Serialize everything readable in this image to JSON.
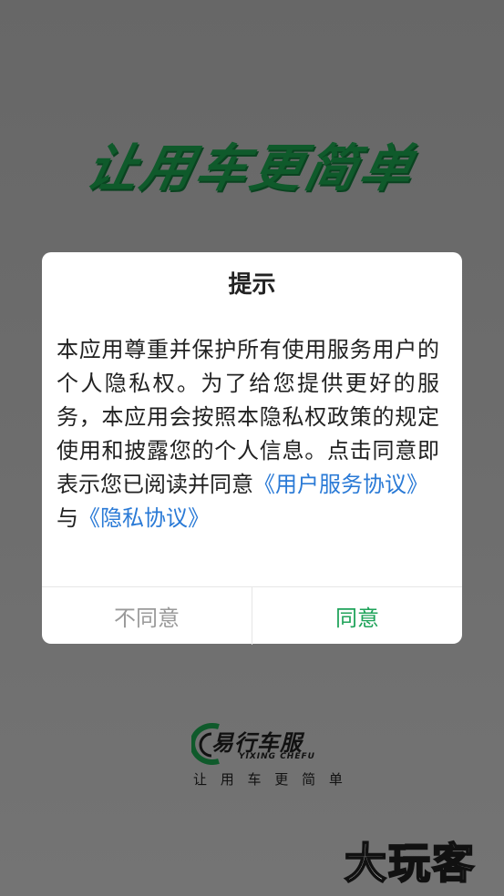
{
  "background": {
    "slogan": "让用车更简单"
  },
  "dialog": {
    "title": "提示",
    "body_text": "本应用尊重并保护所有使用服务用户的个人隐私权。为了给您提供更好的服务，本应用会按照本隐私权政策的规定使用和披露您的个人信息。点击同意即表示您已阅读并同意",
    "user_agreement_link": "《用户服务协议》",
    "connector": "与",
    "privacy_link": "《隐私协议》",
    "disagree_label": "不同意",
    "agree_label": "同意"
  },
  "brand": {
    "name": "易行车服",
    "name_en": "YIXING CHEFU",
    "slogan": "让 用 车 更 简 单"
  },
  "watermark": "大玩客",
  "colors": {
    "agree": "#1fa35a",
    "link": "#2a7ad6",
    "slogan": "#0f5a2b"
  }
}
